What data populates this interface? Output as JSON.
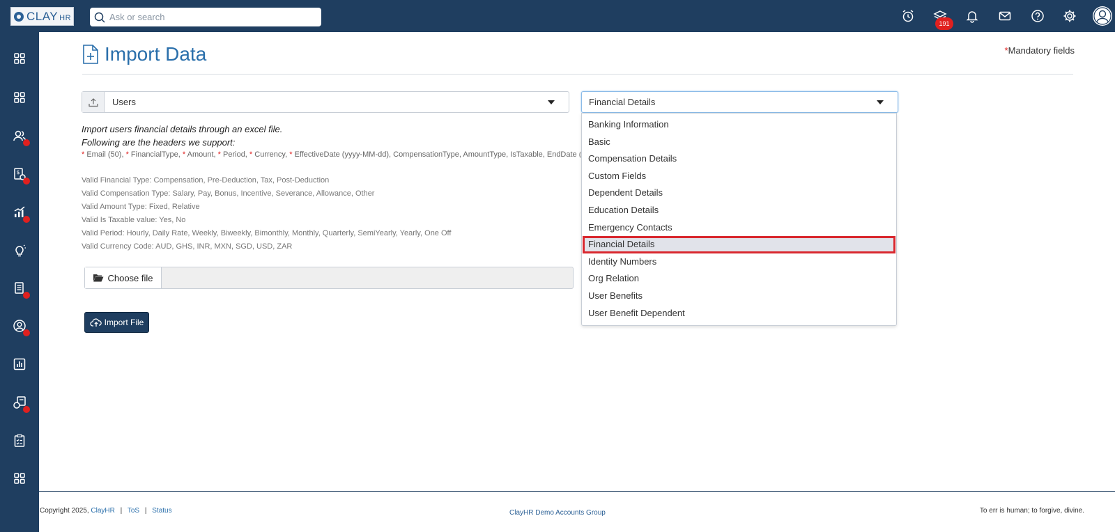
{
  "app": {
    "logo_text": "CLAY",
    "logo_sub": "HR",
    "search_placeholder": "Ask or search",
    "notification_badge": "191"
  },
  "page": {
    "title": "Import Data",
    "mandatory_star": "*",
    "mandatory_label": "Mandatory fields"
  },
  "form": {
    "entity_select_value": "Users",
    "type_select_value": "Financial Details",
    "description_line1": "Import users financial details through an excel file.",
    "description_line2": "Following are the headers we support:",
    "headers_text": "* Email (50), * FinancialType, * Amount, * Period, * Currency, * EffectiveDate (yyyy-MM-dd), CompensationType, AmountType, IsTaxable, EndDate (y",
    "valid_lines": [
      "Valid Financial Type: Compensation, Pre-Deduction, Tax, Post-Deduction",
      "Valid Compensation Type: Salary, Pay, Bonus, Incentive, Severance, Allowance, Other",
      "Valid Amount Type: Fixed, Relative",
      "Valid Is Taxable value: Yes, No",
      "Valid Period: Hourly, Daily Rate, Weekly, Biweekly, Bimonthly, Monthly, Quarterly, SemiYearly, Yearly, One Off",
      "Valid Currency Code: AUD, GHS, INR, MXN, SGD, USD, ZAR"
    ],
    "choose_file_label": "Choose file",
    "import_button_label": "Import File"
  },
  "dropdown": {
    "options": [
      "Banking Information",
      "Basic",
      "Compensation Details",
      "Custom Fields",
      "Dependent Details",
      "Education Details",
      "Emergency Contacts",
      "Financial Details",
      "Identity Numbers",
      "Org Relation",
      "User Benefits",
      "User Benefit Dependent"
    ],
    "selected_index": 7
  },
  "footer": {
    "copyright": "Copyright 2025,",
    "company_link": "ClayHR",
    "sep1": "|",
    "tos_link": "ToS",
    "sep2": "|",
    "status_link": "Status",
    "center_text": "ClayHR Demo Accounts Group",
    "quote": "To err is human; to forgive, divine."
  },
  "colors": {
    "navbar": "#1f3e60",
    "accent": "#2a6fab",
    "badge": "#e0201f",
    "highlight_border": "#d9272e"
  },
  "icons": {
    "top": [
      "alarm-icon",
      "stack-icon",
      "bell-icon",
      "mail-icon",
      "help-icon",
      "gear-icon",
      "user-avatar-icon"
    ],
    "sidebar": [
      "grid-icon",
      "grid-icon",
      "users-icon",
      "payroll-icon",
      "chart-growth-icon",
      "idea-icon",
      "documents-icon",
      "profile-icon",
      "report-icon",
      "timesheet-icon",
      "checklist-icon",
      "grid-icon"
    ]
  }
}
